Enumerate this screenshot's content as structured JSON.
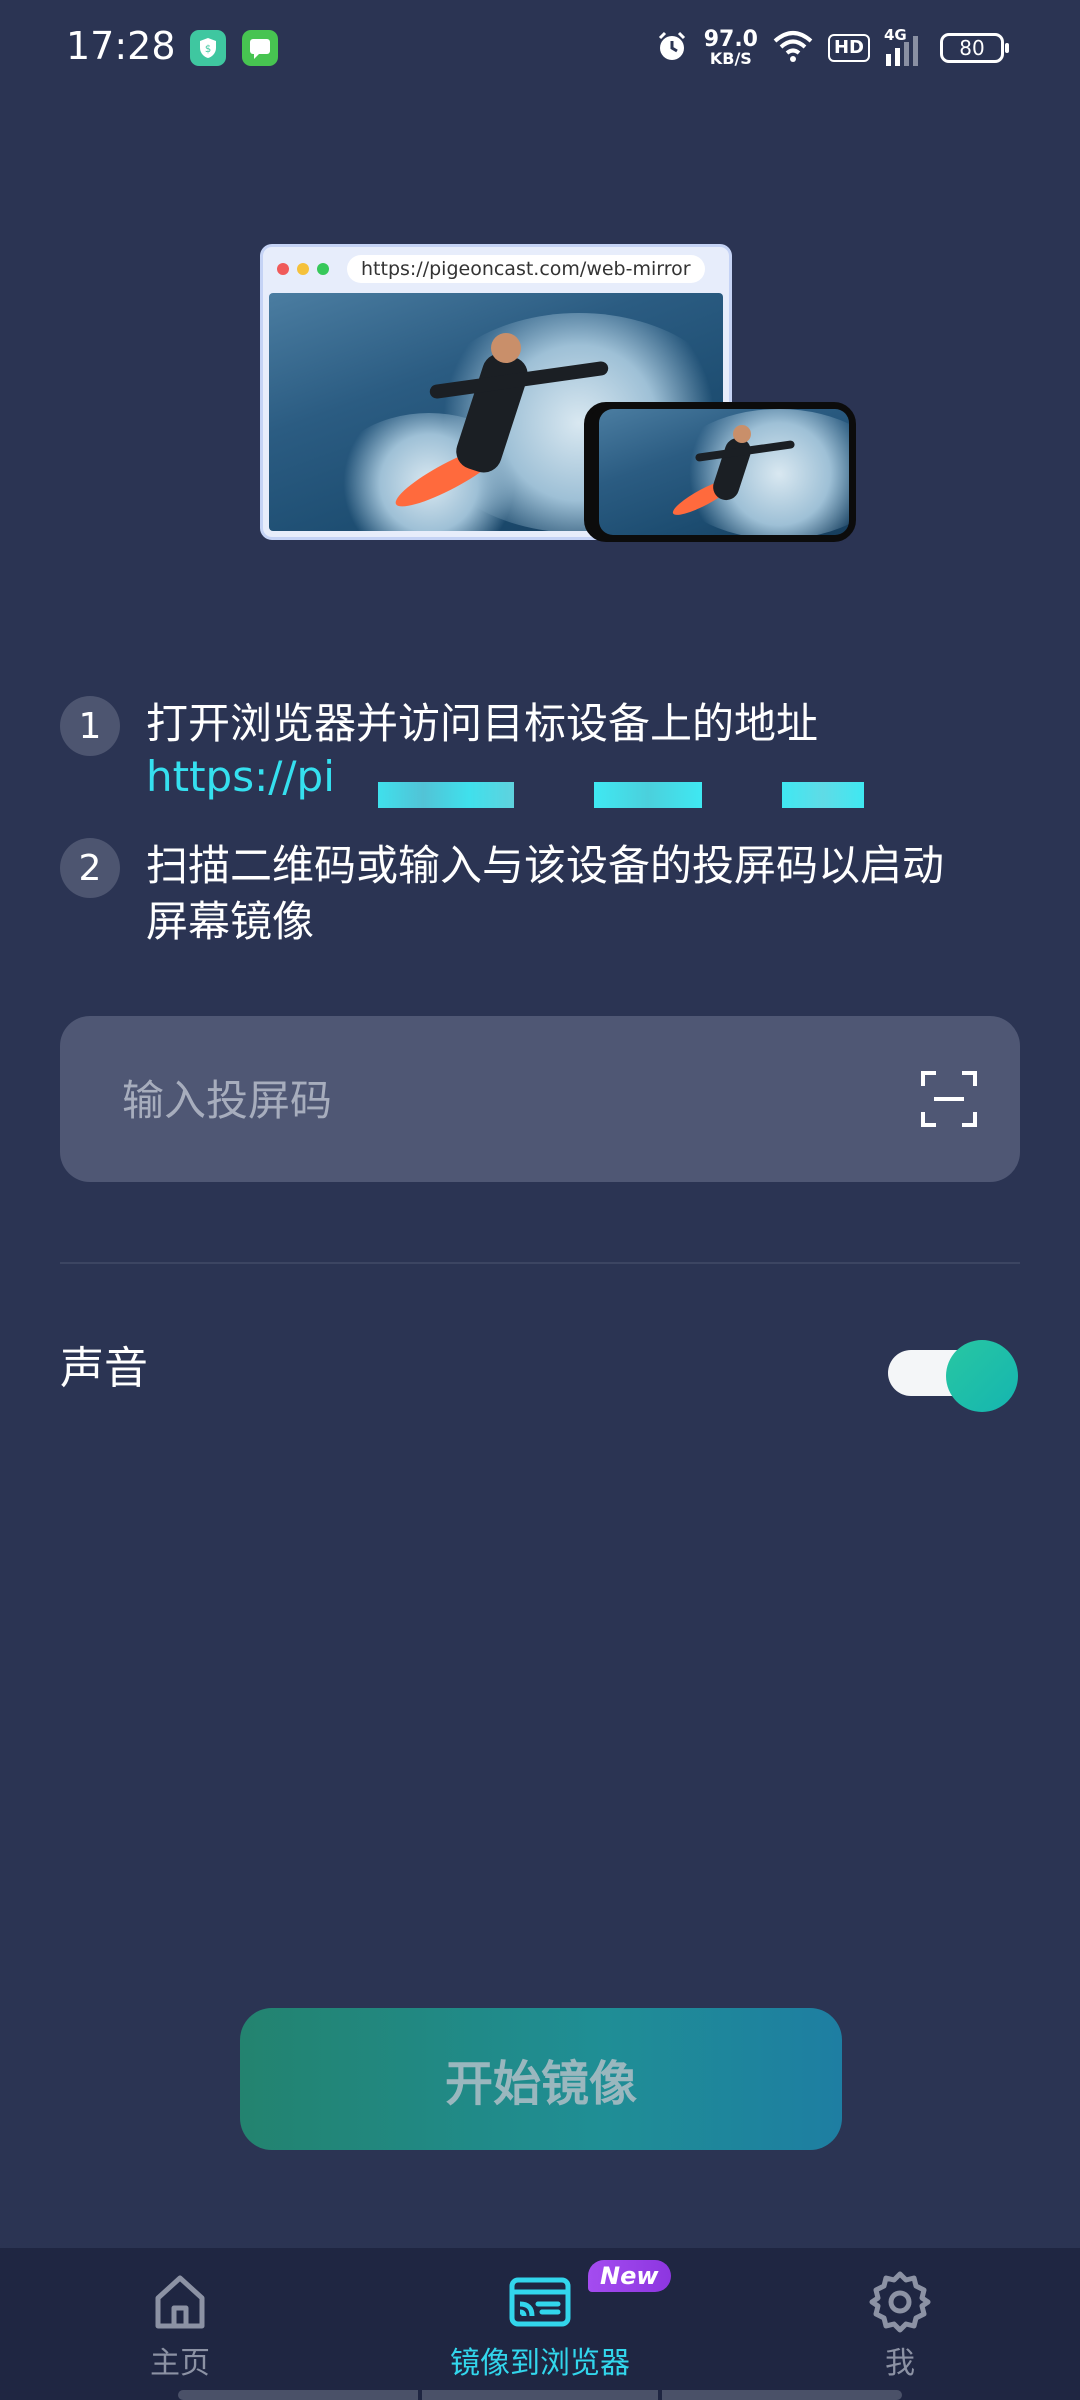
{
  "status_bar": {
    "time": "17:28",
    "net_speed_value": "97.0",
    "net_speed_unit": "KB/S",
    "hd": "HD",
    "network": "4G",
    "battery": "80"
  },
  "hero": {
    "url": "https://pigeoncast.com/web-mirror"
  },
  "steps": [
    {
      "number": "1",
      "text": "打开浏览器并访问目标设备上的地址"
    },
    {
      "number": "2",
      "text_line1": "扫描二维码或输入与该设备的投屏码以启动",
      "text_line2": "屏幕镜像"
    }
  ],
  "link_text": "https://pi",
  "code_input": {
    "placeholder": "输入投屏码",
    "value": ""
  },
  "sound": {
    "label": "声音",
    "enabled": true
  },
  "start_button": "开始镜像",
  "nav": {
    "items": [
      {
        "label": "主页",
        "icon": "home-icon",
        "active": false
      },
      {
        "label": "镜像到浏览器",
        "icon": "cast-icon",
        "active": true,
        "badge": "New"
      },
      {
        "label": "我",
        "icon": "gear-icon",
        "active": false
      }
    ]
  },
  "colors": {
    "background": "#2b3453",
    "accent": "#35e0ef",
    "toggle_on": "#1fbfa8",
    "badge": "#9a42ea"
  }
}
